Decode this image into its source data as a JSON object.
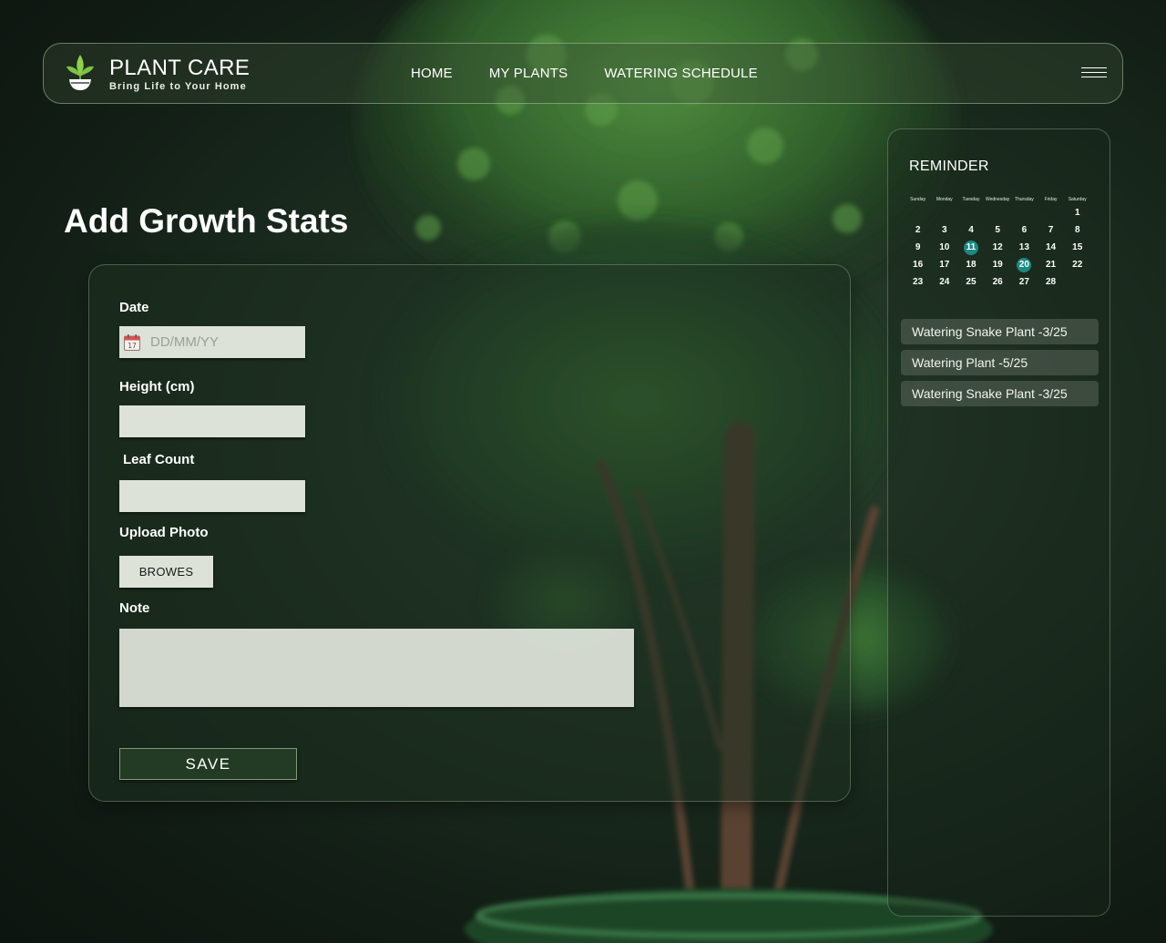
{
  "header": {
    "brand_name": "PLANT CARE",
    "brand_tagline": "Bring Life to Your Home",
    "logo_icon": "plant-sprout-icon",
    "nav": [
      "HOME",
      "MY PLANTS",
      "WATERING SCHEDULE"
    ],
    "menu_icon": "hamburger-menu-icon"
  },
  "page": {
    "title": "Add Growth Stats"
  },
  "form": {
    "date_label": "Date",
    "date_placeholder": "DD/MM/YY",
    "date_icon": "calendar-icon",
    "height_label": "Height (cm)",
    "height_value": "",
    "leaf_label": "Leaf Count",
    "leaf_value": "",
    "upload_label": "Upload Photo",
    "browse_label": "BROWES",
    "note_label": "Note",
    "note_value": "",
    "save_label": "SAVE"
  },
  "reminder": {
    "title": "REMINDER",
    "weekdays": [
      "Sunday",
      "Monday",
      "Tuesday",
      "Wednesday",
      "Thursday",
      "Friday",
      "Saturday"
    ],
    "days": [
      1,
      2,
      3,
      4,
      5,
      6,
      7,
      8,
      9,
      10,
      11,
      12,
      13,
      14,
      15,
      16,
      17,
      18,
      19,
      20,
      21,
      22,
      23,
      24,
      25,
      26,
      27,
      28
    ],
    "highlighted_days": [
      11,
      20
    ],
    "highlight_color": "#1a8a82",
    "items": [
      "Watering Snake Plant -3/25",
      "Watering Plant -5/25",
      "Watering Snake Plant -3/25"
    ]
  },
  "colors": {
    "field_bg": "#dce2d8",
    "save_bg": "#233a24",
    "brand_green": "#7cc242"
  }
}
